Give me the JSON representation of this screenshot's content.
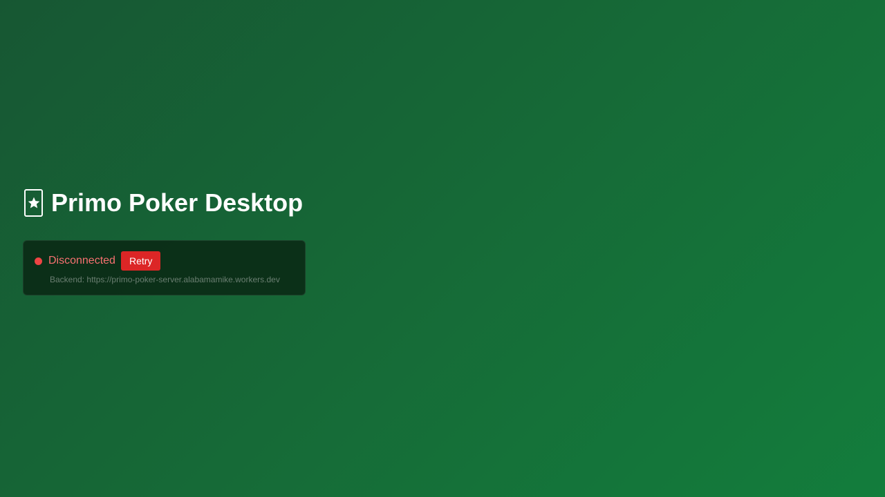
{
  "header": {
    "icon": "playing-card-star-icon",
    "title": "Primo Poker Desktop"
  },
  "connection": {
    "status_text": "Disconnected",
    "status_color": "#ef4444",
    "retry_label": "Retry",
    "backend_label": "Backend:",
    "backend_url": "https://primo-poker-server.alabamamike.workers.dev"
  },
  "colors": {
    "background_start": "#175733",
    "background_end": "#137d3c",
    "retry_button": "#dc2626",
    "status_text": "#f87171"
  }
}
